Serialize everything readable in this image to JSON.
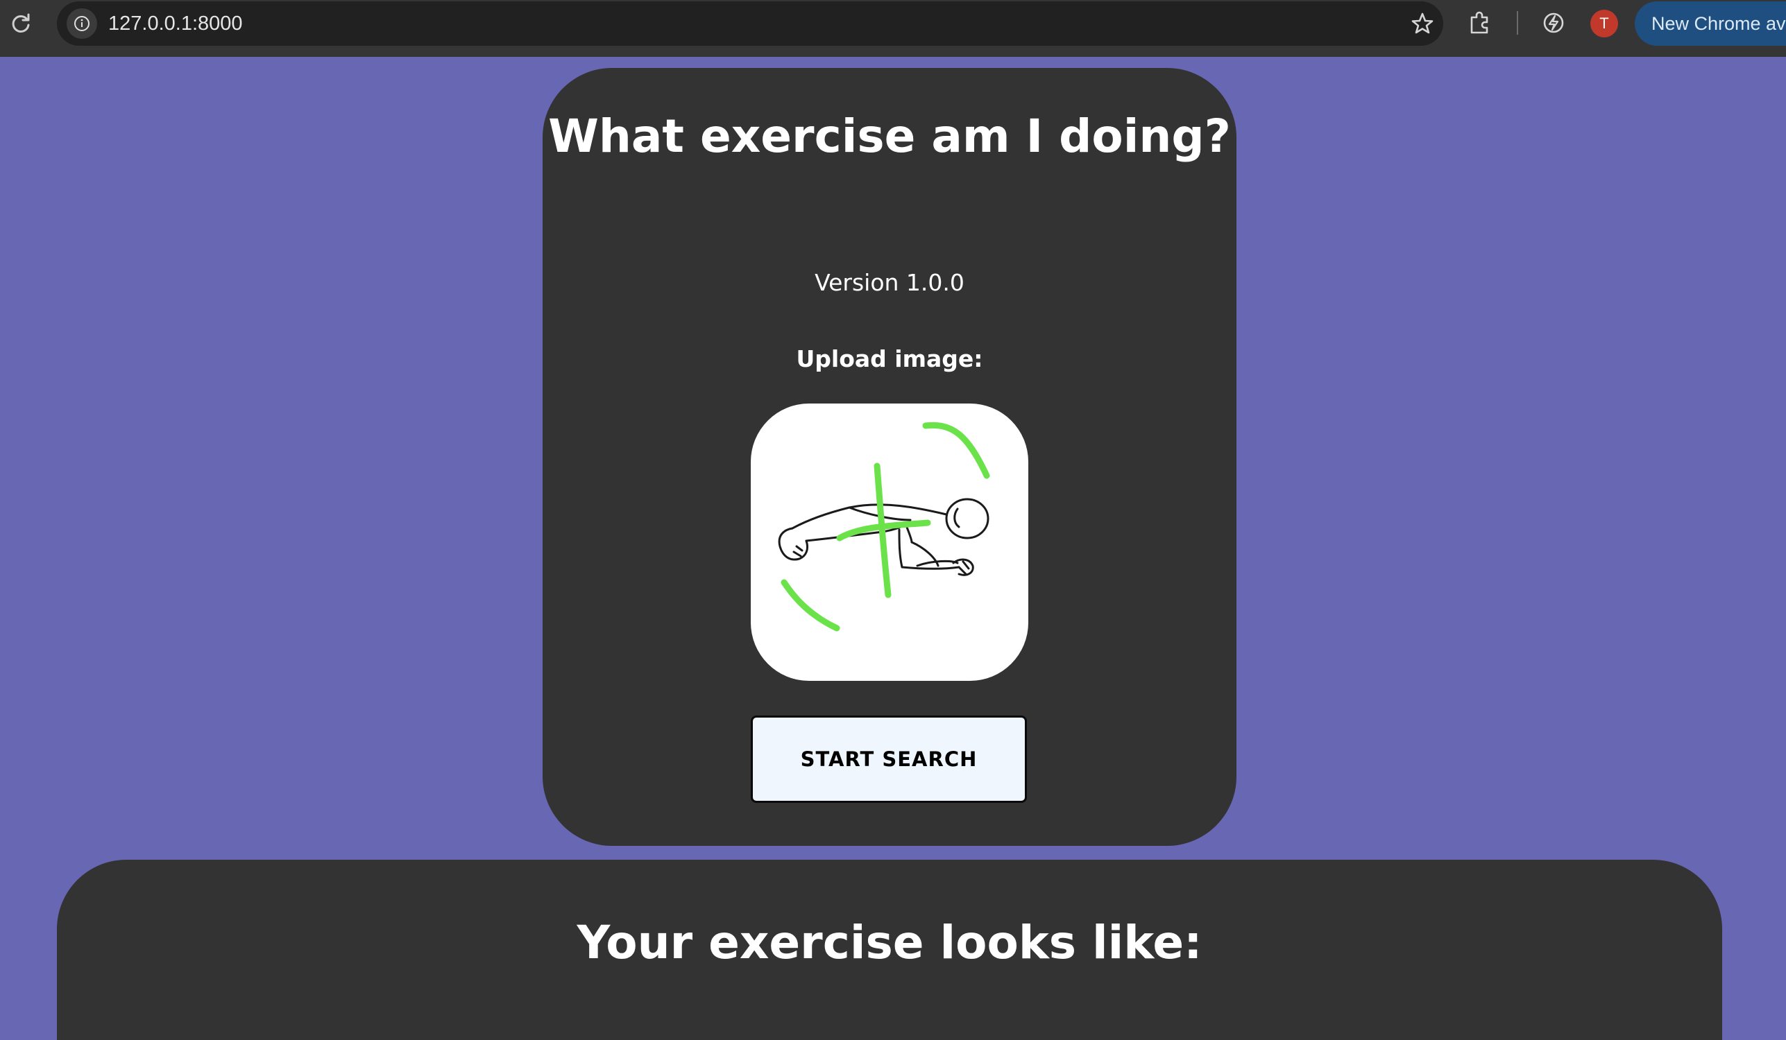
{
  "browser": {
    "url": "127.0.0.1:8000",
    "profile_initial": "T",
    "chrome_badge": "New Chrome av",
    "icons": [
      "reload-icon",
      "site-info-icon",
      "star-icon",
      "extensions-icon",
      "performance-icon"
    ]
  },
  "app": {
    "title": "What exercise am I doing?",
    "version": "Version 1.0.0",
    "upload_label": "Upload image:",
    "start_button": "START SEARCH",
    "results_heading": "Your exercise looks like:"
  },
  "colors": {
    "page_background": "#6767b3",
    "card_background": "#333333",
    "button_background": "#eff6fd",
    "sketch_accent": "#6be24a"
  }
}
